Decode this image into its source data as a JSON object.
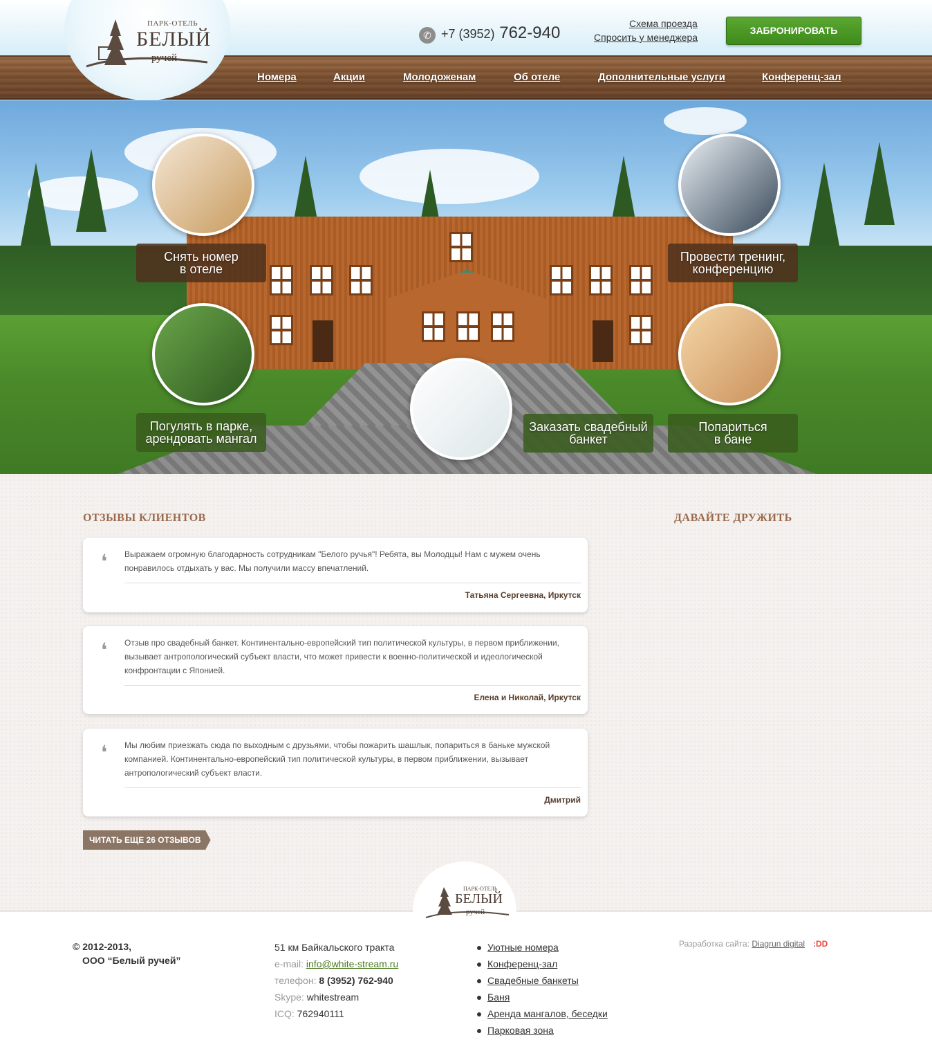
{
  "header": {
    "logo": {
      "small": "ПАРК-ОТЕЛЬ",
      "big": "БЕЛЫЙ",
      "sub": "ручей"
    },
    "phone_code": "+7 (3952)",
    "phone_number": "762-940",
    "links": [
      "Схема проезда",
      "Спросить у менеджера"
    ],
    "book_label": "ЗАБРОНИРОВАТЬ",
    "nav": [
      "Номера",
      "Акции",
      "Молодоженам",
      "Об отеле",
      "Дополнительные услуги",
      "Конференц-зал"
    ]
  },
  "hero": {
    "labels": [
      {
        "line1": "Снять номер",
        "line2": "в отеле"
      },
      {
        "line1": "Провести тренинг,",
        "line2": "конференцию"
      },
      {
        "line1": "Погулять в парке,",
        "line2": "арендовать мангал"
      },
      {
        "line1": "Заказать свадебный",
        "line2": "банкет"
      },
      {
        "line1": "Попариться",
        "line2": "в бане"
      }
    ]
  },
  "reviews": {
    "title": "ОТЗЫВЫ КЛИЕНТОВ",
    "items": [
      {
        "text": "Выражаем огромную благодарность сотрудникам \"Белого ручья\"! Ребята, вы Молодцы! Нам с мужем очень понравилось отдыхать у вас. Мы получили массу впечатлений.",
        "author": "Татьяна Сергеевна, Иркутск"
      },
      {
        "text": "Отзыв про свадебный банкет. Континентально-европейский тип политической культуры, в первом приближении, вызывает антропологический субъект власти, что может привести к военно-политической и идеологической конфронтации с Японией.",
        "author": "Елена и Николай, Иркутск"
      },
      {
        "text": "Мы любим приезжать сюда по выходным с друзьями, чтобы пожарить шашлык, попариться в баньке мужской компанией. Континентально-европейский тип политической культуры, в первом приближении, вызывает антропологический субъект власти.",
        "author": "Дмитрий"
      }
    ],
    "more_label": "ЧИТАТЬ ЕЩЕ 26 ОТЗЫВОВ"
  },
  "friends": {
    "title": "ДАВАЙТЕ ДРУЖИТЬ"
  },
  "footer": {
    "copyright_line1": "© 2012-2013,",
    "copyright_line2": "ООО “Белый ручей”",
    "address": "51 км Байкальского тракта",
    "email_label": "e-mail:",
    "email": "info@white-stream.ru",
    "phone_label": "телефон:",
    "phone": "8 (3952) 762-940",
    "skype_label": "Skype:",
    "skype": "whitestream",
    "icq_label": "ICQ:",
    "icq": "762940111",
    "links": [
      "Уютные номера",
      "Конференц-зал",
      "Свадебные банкеты",
      "Баня",
      "Аренда мангалов, беседки",
      "Парковая зона"
    ],
    "dev_label": "Разработка сайта:",
    "dev_link": "Diagrun digital",
    "dev_logo": ":DD"
  },
  "colors": {
    "accent_green": "#4a9a26",
    "brown_heading": "#9b6a4b",
    "wood": "#7a4f2f"
  },
  "icons": [
    "phone-icon",
    "quote-icon",
    "tree-logo-icon"
  ]
}
